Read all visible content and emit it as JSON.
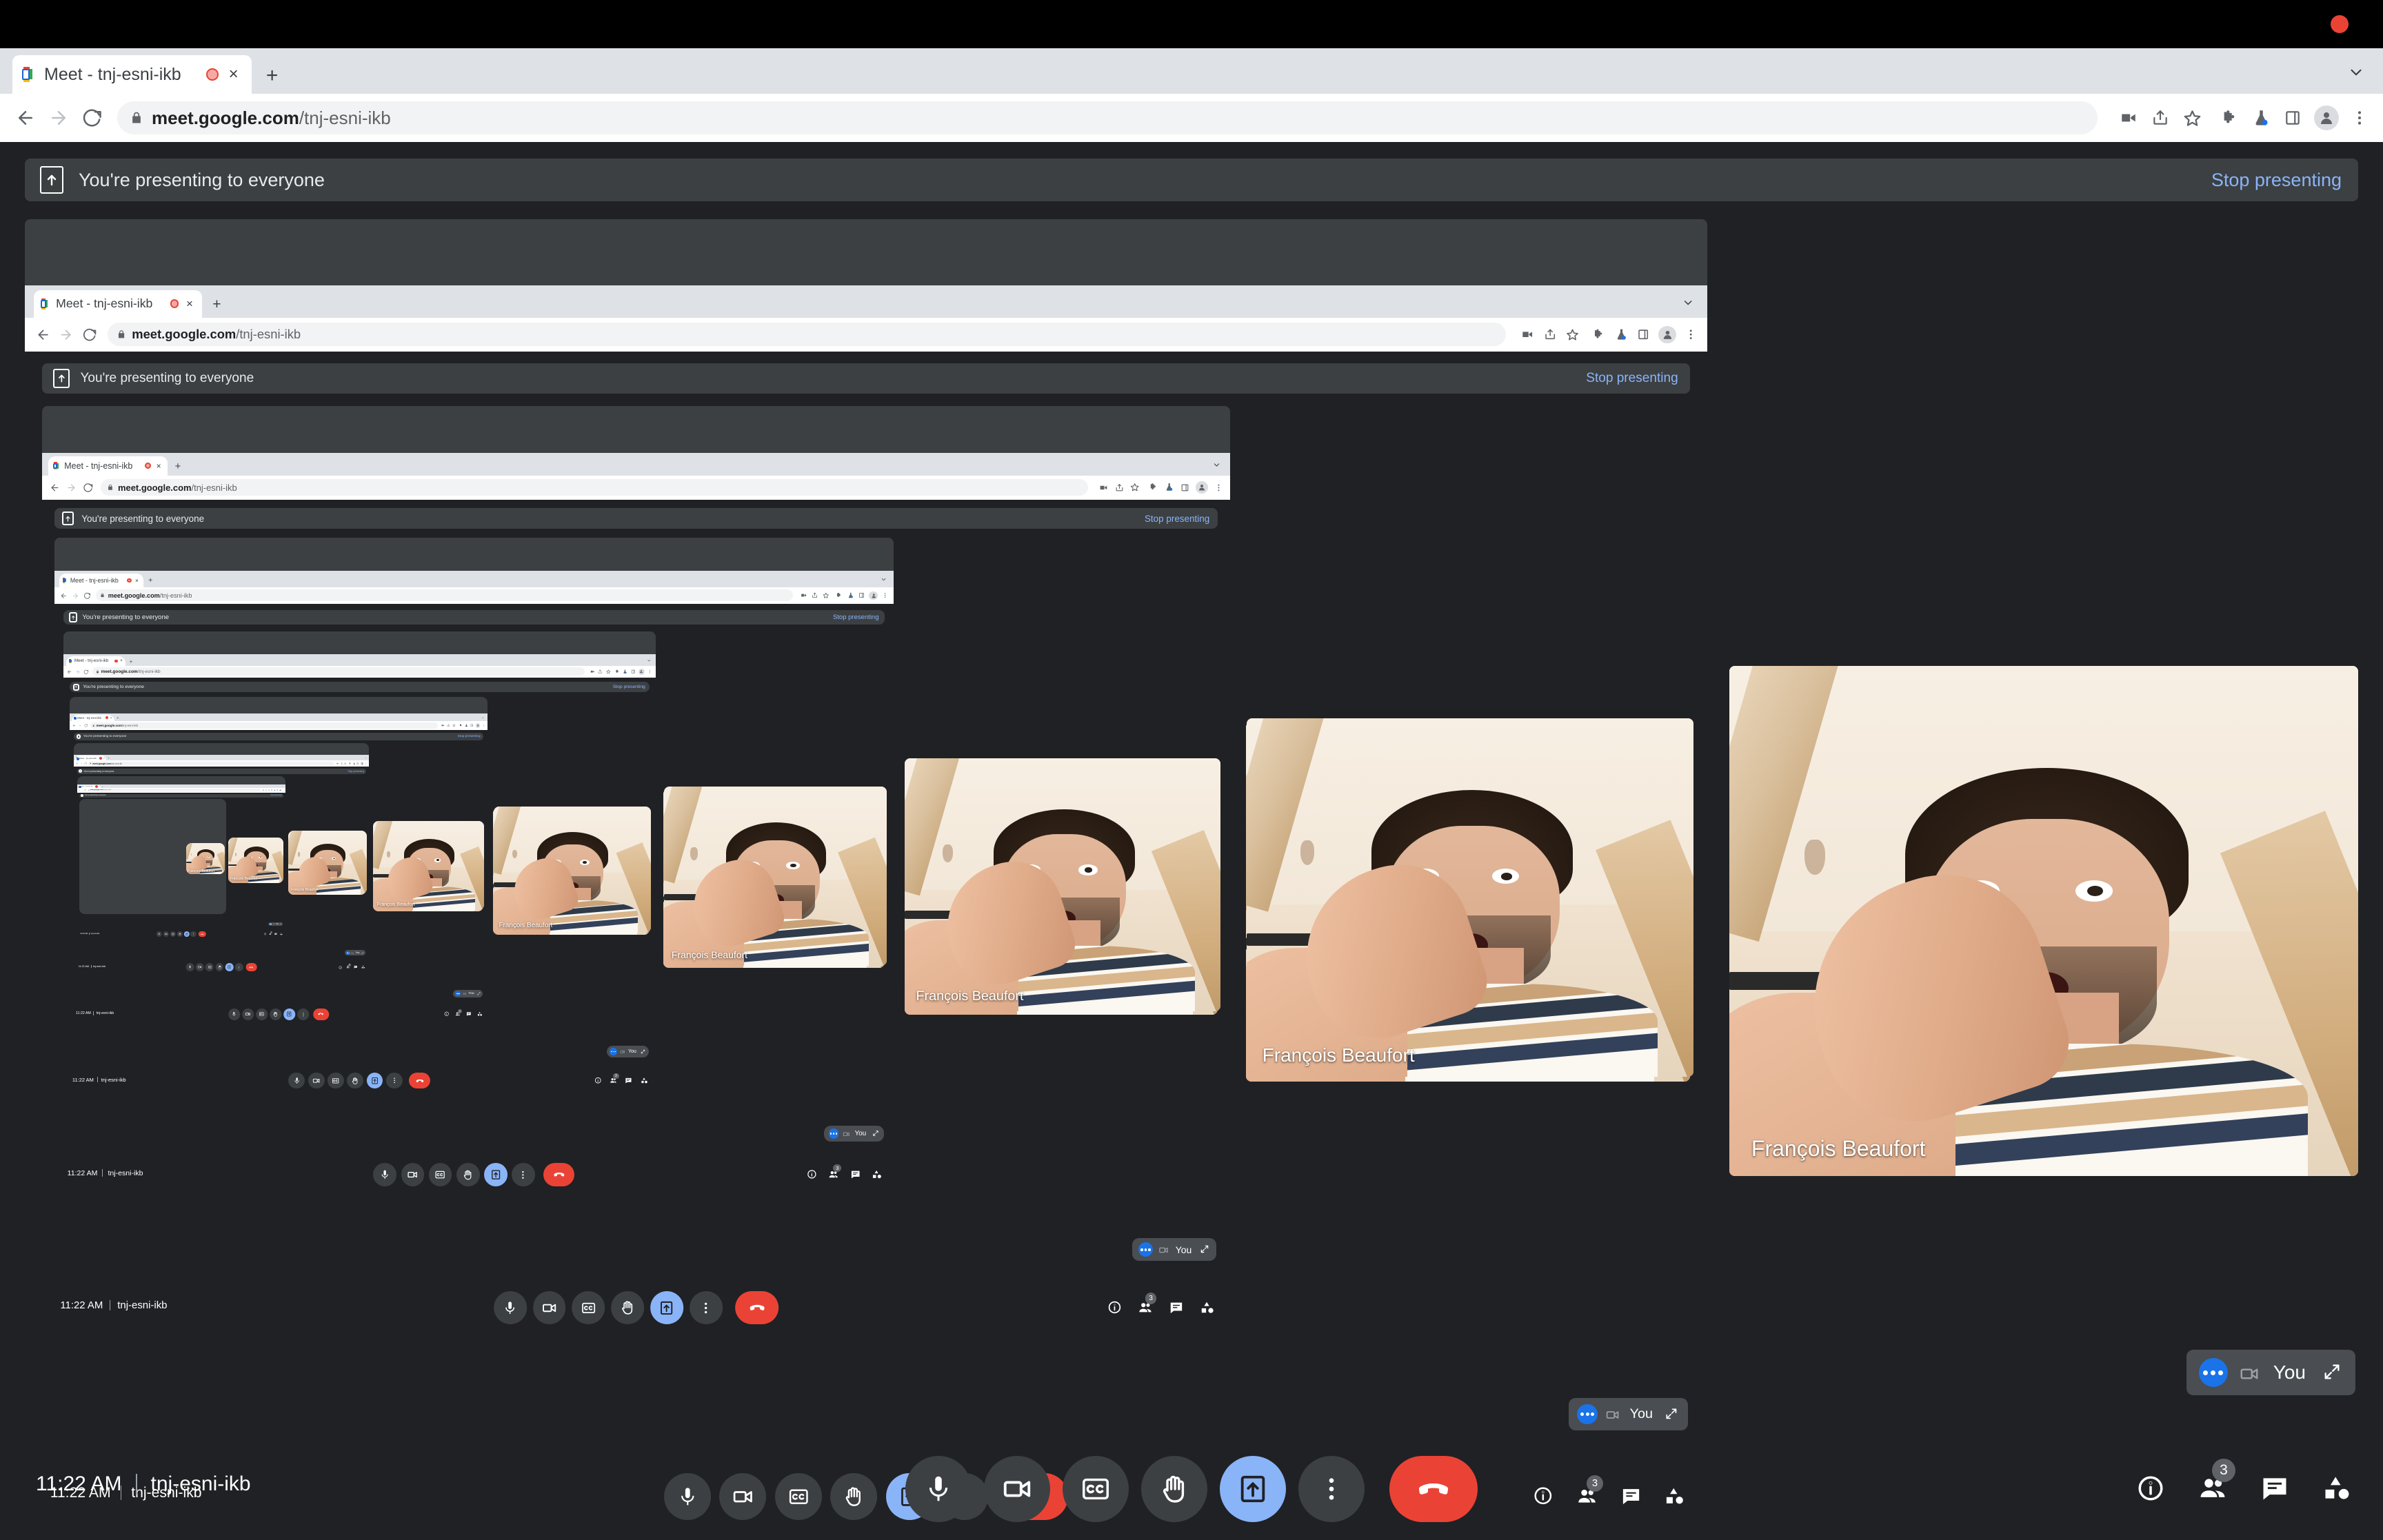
{
  "os": {
    "recording_indicator": "recording-dot"
  },
  "browser": {
    "tab": {
      "title": "Meet - tnj-esni-ikb",
      "favicon": "google-meet-favicon",
      "recording_icon": "tab-recording-icon",
      "close_label": "×",
      "new_tab_label": "+"
    },
    "tabstrip_chevron": "chevron-down-icon",
    "nav": {
      "back": "back-arrow-icon",
      "forward": "forward-arrow-icon",
      "reload": "reload-icon"
    },
    "omnibox": {
      "lock": "lock-icon",
      "host": "meet.google.com",
      "path": "/tnj-esni-ikb",
      "full_url": "meet.google.com/tnj-esni-ikb"
    },
    "toolbar_icons": [
      "video-camera-icon",
      "share-icon",
      "bookmark-star-icon",
      "extensions-puzzle-icon",
      "experiments-flask-icon",
      "side-panel-icon",
      "profile-avatar-icon",
      "three-dot-menu-icon"
    ]
  },
  "meet": {
    "banner": {
      "icon": "present-screen-icon",
      "text": "You're presenting to everyone",
      "stop_label": "Stop presenting"
    },
    "participant_name": "François Beaufort",
    "self_view": {
      "more_icon": "blue-more-dots-icon",
      "camera_icon": "camera-icon",
      "label": "You",
      "expand_icon": "expand-diagonal-icon"
    },
    "bottom_bar": {
      "time": "11:22 AM",
      "separator": "|",
      "meeting_code": "tnj-esni-ikb",
      "controls": [
        {
          "name": "microphone",
          "icon": "microphone-icon",
          "state": "off"
        },
        {
          "name": "camera",
          "icon": "camera-icon",
          "state": "off"
        },
        {
          "name": "captions",
          "icon": "closed-captions-icon",
          "state": "off"
        },
        {
          "name": "raise-hand",
          "icon": "raised-hand-icon",
          "state": "off"
        },
        {
          "name": "present-now",
          "icon": "present-screen-icon",
          "state": "active"
        },
        {
          "name": "more-options",
          "icon": "three-dot-vertical-icon",
          "state": "off"
        },
        {
          "name": "leave-call",
          "icon": "end-call-icon",
          "state": "hangup"
        }
      ],
      "right_icons": [
        {
          "name": "meeting-details",
          "icon": "info-circle-icon",
          "badge": null
        },
        {
          "name": "show-everyone",
          "icon": "people-icon",
          "badge": "3"
        },
        {
          "name": "chat",
          "icon": "chat-bubble-icon",
          "badge": null
        },
        {
          "name": "activities",
          "icon": "activities-shapes-icon",
          "badge": null
        }
      ]
    }
  },
  "colors": {
    "meet_background": "#202124",
    "banner_background": "#3c4043",
    "accent_blue": "#8ab4f8",
    "link_blue": "#8ab4f8",
    "hangup_red": "#ea4335",
    "chrome_tabstrip": "#dee1e6",
    "chrome_toolbar": "#ffffff",
    "omnibox": "#f1f3f4"
  },
  "recursion": {
    "description": "infinite-mirror-screen-share",
    "levels": 8
  }
}
